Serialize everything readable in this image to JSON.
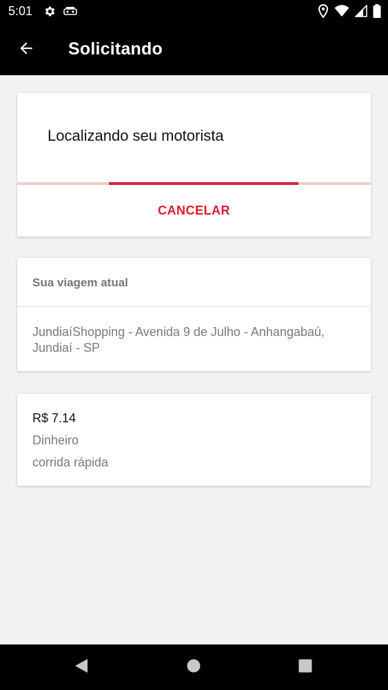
{
  "status_bar": {
    "time": "5:01",
    "icons": [
      "settings-gear-icon",
      "notification-app-icon",
      "location-icon",
      "wifi-icon",
      "signal-icon",
      "battery-icon"
    ]
  },
  "app_bar": {
    "title": "Solicitando",
    "back_icon": "arrow-left-icon"
  },
  "search_card": {
    "title": "Localizando seu motorista",
    "cancel_label": "CANCELAR"
  },
  "trip_card": {
    "header": "Sua viagem atual",
    "address": "JundiaíShopping - Avenida 9 de Julho - Anhangabaú, Jundiaí - SP"
  },
  "payment_card": {
    "fare": "R$ 7.14",
    "method": "Dinheiro",
    "ride_type": "corrida rápida"
  },
  "nav_bar": {
    "buttons": [
      "back-triangle-icon",
      "home-circle-icon",
      "recents-square-icon"
    ]
  },
  "colors": {
    "accent": "#e0192f",
    "progress": "#d0233a",
    "progress_track": "#f3c9cc",
    "background": "#f2f1f3",
    "bar": "#000000"
  }
}
